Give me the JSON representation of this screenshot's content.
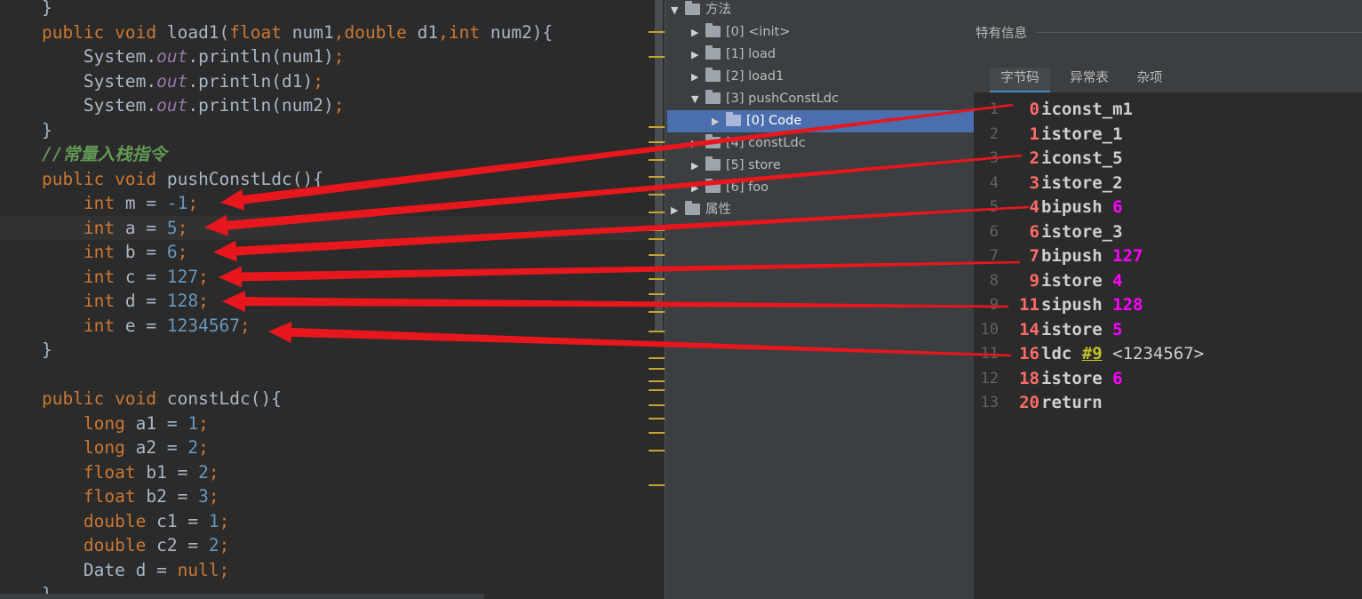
{
  "editor": {
    "lines": [
      {
        "tokens": [
          [
            "pl",
            "    }"
          ]
        ]
      },
      {
        "tokens": [
          [
            "kw",
            "    public void "
          ],
          [
            "fn",
            "load1"
          ],
          [
            "pl",
            "("
          ],
          [
            "kw",
            "float "
          ],
          [
            "pl",
            "num1"
          ],
          [
            "kw",
            ","
          ],
          [
            "kw",
            "double "
          ],
          [
            "pl",
            "d1"
          ],
          [
            "kw",
            ","
          ],
          [
            "kw",
            "int "
          ],
          [
            "pl",
            "num2){"
          ]
        ]
      },
      {
        "tokens": [
          [
            "pl",
            "        System."
          ],
          [
            "fld",
            "out"
          ],
          [
            "pl",
            ".println(num1)"
          ],
          [
            "kw",
            ";"
          ]
        ]
      },
      {
        "tokens": [
          [
            "pl",
            "        System."
          ],
          [
            "fld",
            "out"
          ],
          [
            "pl",
            ".println(d1)"
          ],
          [
            "kw",
            ";"
          ]
        ]
      },
      {
        "tokens": [
          [
            "pl",
            "        System."
          ],
          [
            "fld",
            "out"
          ],
          [
            "pl",
            ".println(num2)"
          ],
          [
            "kw",
            ";"
          ]
        ]
      },
      {
        "tokens": [
          [
            "pl",
            "    }"
          ]
        ]
      },
      {
        "tokens": [
          [
            "cmt",
            "    //常量入栈指令"
          ]
        ]
      },
      {
        "tokens": [
          [
            "kw",
            "    public void "
          ],
          [
            "fn",
            "pushConstLdc"
          ],
          [
            "pl",
            "(){"
          ]
        ]
      },
      {
        "tokens": [
          [
            "kw",
            "        int "
          ],
          [
            "pl",
            "m = "
          ],
          [
            "num",
            "-1"
          ],
          [
            "kw",
            ";"
          ]
        ]
      },
      {
        "tokens": [
          [
            "kw",
            "        int "
          ],
          [
            "pl",
            "a = "
          ],
          [
            "num",
            "5"
          ],
          [
            "kw",
            ";"
          ]
        ]
      },
      {
        "tokens": [
          [
            "kw",
            "        int "
          ],
          [
            "pl",
            "b = "
          ],
          [
            "num",
            "6"
          ],
          [
            "kw",
            ";"
          ]
        ]
      },
      {
        "tokens": [
          [
            "kw",
            "        int "
          ],
          [
            "pl",
            "c = "
          ],
          [
            "num",
            "127"
          ],
          [
            "kw",
            ";"
          ]
        ]
      },
      {
        "tokens": [
          [
            "kw",
            "        int "
          ],
          [
            "pl",
            "d = "
          ],
          [
            "num",
            "128"
          ],
          [
            "kw",
            ";"
          ]
        ]
      },
      {
        "tokens": [
          [
            "kw",
            "        int "
          ],
          [
            "pl",
            "e = "
          ],
          [
            "num",
            "1234567"
          ],
          [
            "kw",
            ";"
          ]
        ]
      },
      {
        "tokens": [
          [
            "pl",
            "    }"
          ]
        ]
      },
      {
        "tokens": [
          [
            "pl",
            ""
          ]
        ]
      },
      {
        "tokens": [
          [
            "kw",
            "    public void "
          ],
          [
            "fn",
            "constLdc"
          ],
          [
            "pl",
            "(){"
          ]
        ]
      },
      {
        "tokens": [
          [
            "kw",
            "        long "
          ],
          [
            "pl",
            "a1 = "
          ],
          [
            "num",
            "1"
          ],
          [
            "kw",
            ";"
          ]
        ]
      },
      {
        "tokens": [
          [
            "kw",
            "        long "
          ],
          [
            "pl",
            "a2 = "
          ],
          [
            "num",
            "2"
          ],
          [
            "kw",
            ";"
          ]
        ]
      },
      {
        "tokens": [
          [
            "kw",
            "        float "
          ],
          [
            "pl",
            "b1 = "
          ],
          [
            "num",
            "2"
          ],
          [
            "kw",
            ";"
          ]
        ]
      },
      {
        "tokens": [
          [
            "kw",
            "        float "
          ],
          [
            "pl",
            "b2 = "
          ],
          [
            "num",
            "3"
          ],
          [
            "kw",
            ";"
          ]
        ]
      },
      {
        "tokens": [
          [
            "kw",
            "        double "
          ],
          [
            "pl",
            "c1 = "
          ],
          [
            "num",
            "1"
          ],
          [
            "kw",
            ";"
          ]
        ]
      },
      {
        "tokens": [
          [
            "kw",
            "        double "
          ],
          [
            "pl",
            "c2 = "
          ],
          [
            "num",
            "2"
          ],
          [
            "kw",
            ";"
          ]
        ]
      },
      {
        "tokens": [
          [
            "pl",
            "        Date d = "
          ],
          [
            "kw",
            "null;"
          ]
        ]
      },
      {
        "tokens": [
          [
            "pl",
            "    }"
          ]
        ]
      }
    ]
  },
  "tree": {
    "items": [
      {
        "arrow": "down",
        "label": "方法",
        "indent": 0,
        "selected": false
      },
      {
        "arrow": "right",
        "label": "[0] <init>",
        "indent": 1,
        "selected": false
      },
      {
        "arrow": "right",
        "label": "[1] load",
        "indent": 1,
        "selected": false
      },
      {
        "arrow": "right",
        "label": "[2] load1",
        "indent": 1,
        "selected": false
      },
      {
        "arrow": "down",
        "label": "[3] pushConstLdc",
        "indent": 1,
        "selected": false
      },
      {
        "arrow": "right",
        "label": "[0] Code",
        "indent": 2,
        "selected": true
      },
      {
        "arrow": "right",
        "label": "[4] constLdc",
        "indent": 1,
        "selected": false
      },
      {
        "arrow": "right",
        "label": "[5] store",
        "indent": 1,
        "selected": false
      },
      {
        "arrow": "right",
        "label": "[6] foo",
        "indent": 1,
        "selected": false
      },
      {
        "arrow": "right",
        "label": "属性",
        "indent": 0,
        "selected": false
      }
    ]
  },
  "info": {
    "title": "特有信息",
    "tabs": [
      "字节码",
      "异常表",
      "杂项"
    ],
    "active_tab": 0
  },
  "bytecode": [
    {
      "ln": "1",
      "off": "0",
      "op": "iconst_m1",
      "arg": "",
      "ref": "",
      "cmt": ""
    },
    {
      "ln": "2",
      "off": "1",
      "op": "istore_1",
      "arg": "",
      "ref": "",
      "cmt": ""
    },
    {
      "ln": "3",
      "off": "2",
      "op": "iconst_5",
      "arg": "",
      "ref": "",
      "cmt": ""
    },
    {
      "ln": "4",
      "off": "3",
      "op": "istore_2",
      "arg": "",
      "ref": "",
      "cmt": ""
    },
    {
      "ln": "5",
      "off": "4",
      "op": "bipush",
      "arg": "6",
      "ref": "",
      "cmt": ""
    },
    {
      "ln": "6",
      "off": "6",
      "op": "istore_3",
      "arg": "",
      "ref": "",
      "cmt": ""
    },
    {
      "ln": "7",
      "off": "7",
      "op": "bipush",
      "arg": "127",
      "ref": "",
      "cmt": ""
    },
    {
      "ln": "8",
      "off": "9",
      "op": "istore",
      "arg": "4",
      "ref": "",
      "cmt": ""
    },
    {
      "ln": "9",
      "off": "11",
      "op": "sipush",
      "arg": "128",
      "ref": "",
      "cmt": ""
    },
    {
      "ln": "10",
      "off": "14",
      "op": "istore",
      "arg": "5",
      "ref": "",
      "cmt": ""
    },
    {
      "ln": "11",
      "off": "16",
      "op": "ldc",
      "arg": "",
      "ref": "#9",
      "cmt": "<1234567>"
    },
    {
      "ln": "12",
      "off": "18",
      "op": "istore",
      "arg": "6",
      "ref": "",
      "cmt": ""
    },
    {
      "ln": "13",
      "off": "20",
      "op": "return",
      "arg": "",
      "ref": "",
      "cmt": ""
    }
  ],
  "colors": {
    "arrow": "#e8161d",
    "selection": "#4b6eaf",
    "offset": "#ff6b68",
    "argument": "#ff00ff"
  }
}
